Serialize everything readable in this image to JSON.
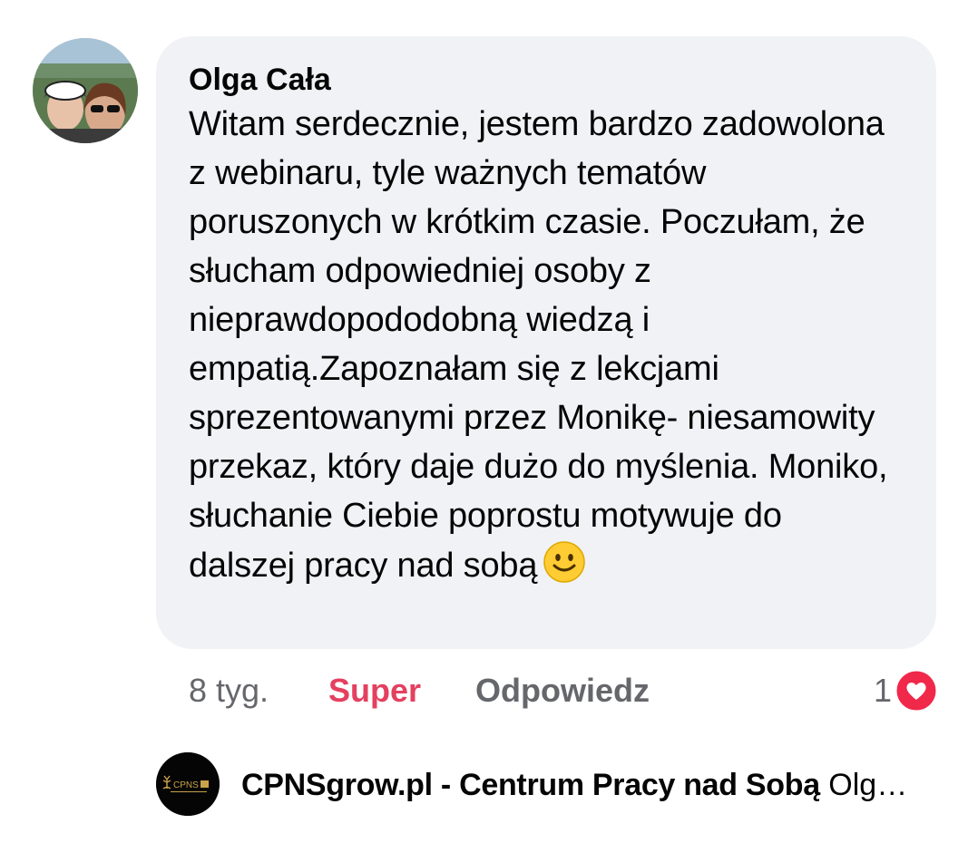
{
  "comment": {
    "author": "Olga Cała",
    "text": "Witam serdecznie, jestem bardzo zadowolona z webinaru, tyle ważnych tematów poruszonych w krótkim czasie. Poczułam, że słucham odpowiedniej osoby z nieprawdopododobną wiedzą i empatią.Zapoznałam się z lekcjami sprezentowanymi przez Monikę- niesamowity przekaz, który daje dużo do myślenia. Moniko, słuchanie Ciebie poprostu motywuje do dalszej pracy nad sobą",
    "emoji": "smiling-face-icon",
    "age": "8 tyg.",
    "reaction_label": "Super",
    "reply_label": "Odpowiedz",
    "reaction_count": "1",
    "reaction_icon": "heart-icon"
  },
  "reply": {
    "author": "CPNSgrow.pl - Centrum Pracy nad Sobą",
    "snippet": "Olg…",
    "avatar_logo": "CPNS"
  },
  "colors": {
    "bubble_bg": "#f0f2f5",
    "reaction_red": "#e4405f",
    "meta_gray": "#65676b"
  }
}
